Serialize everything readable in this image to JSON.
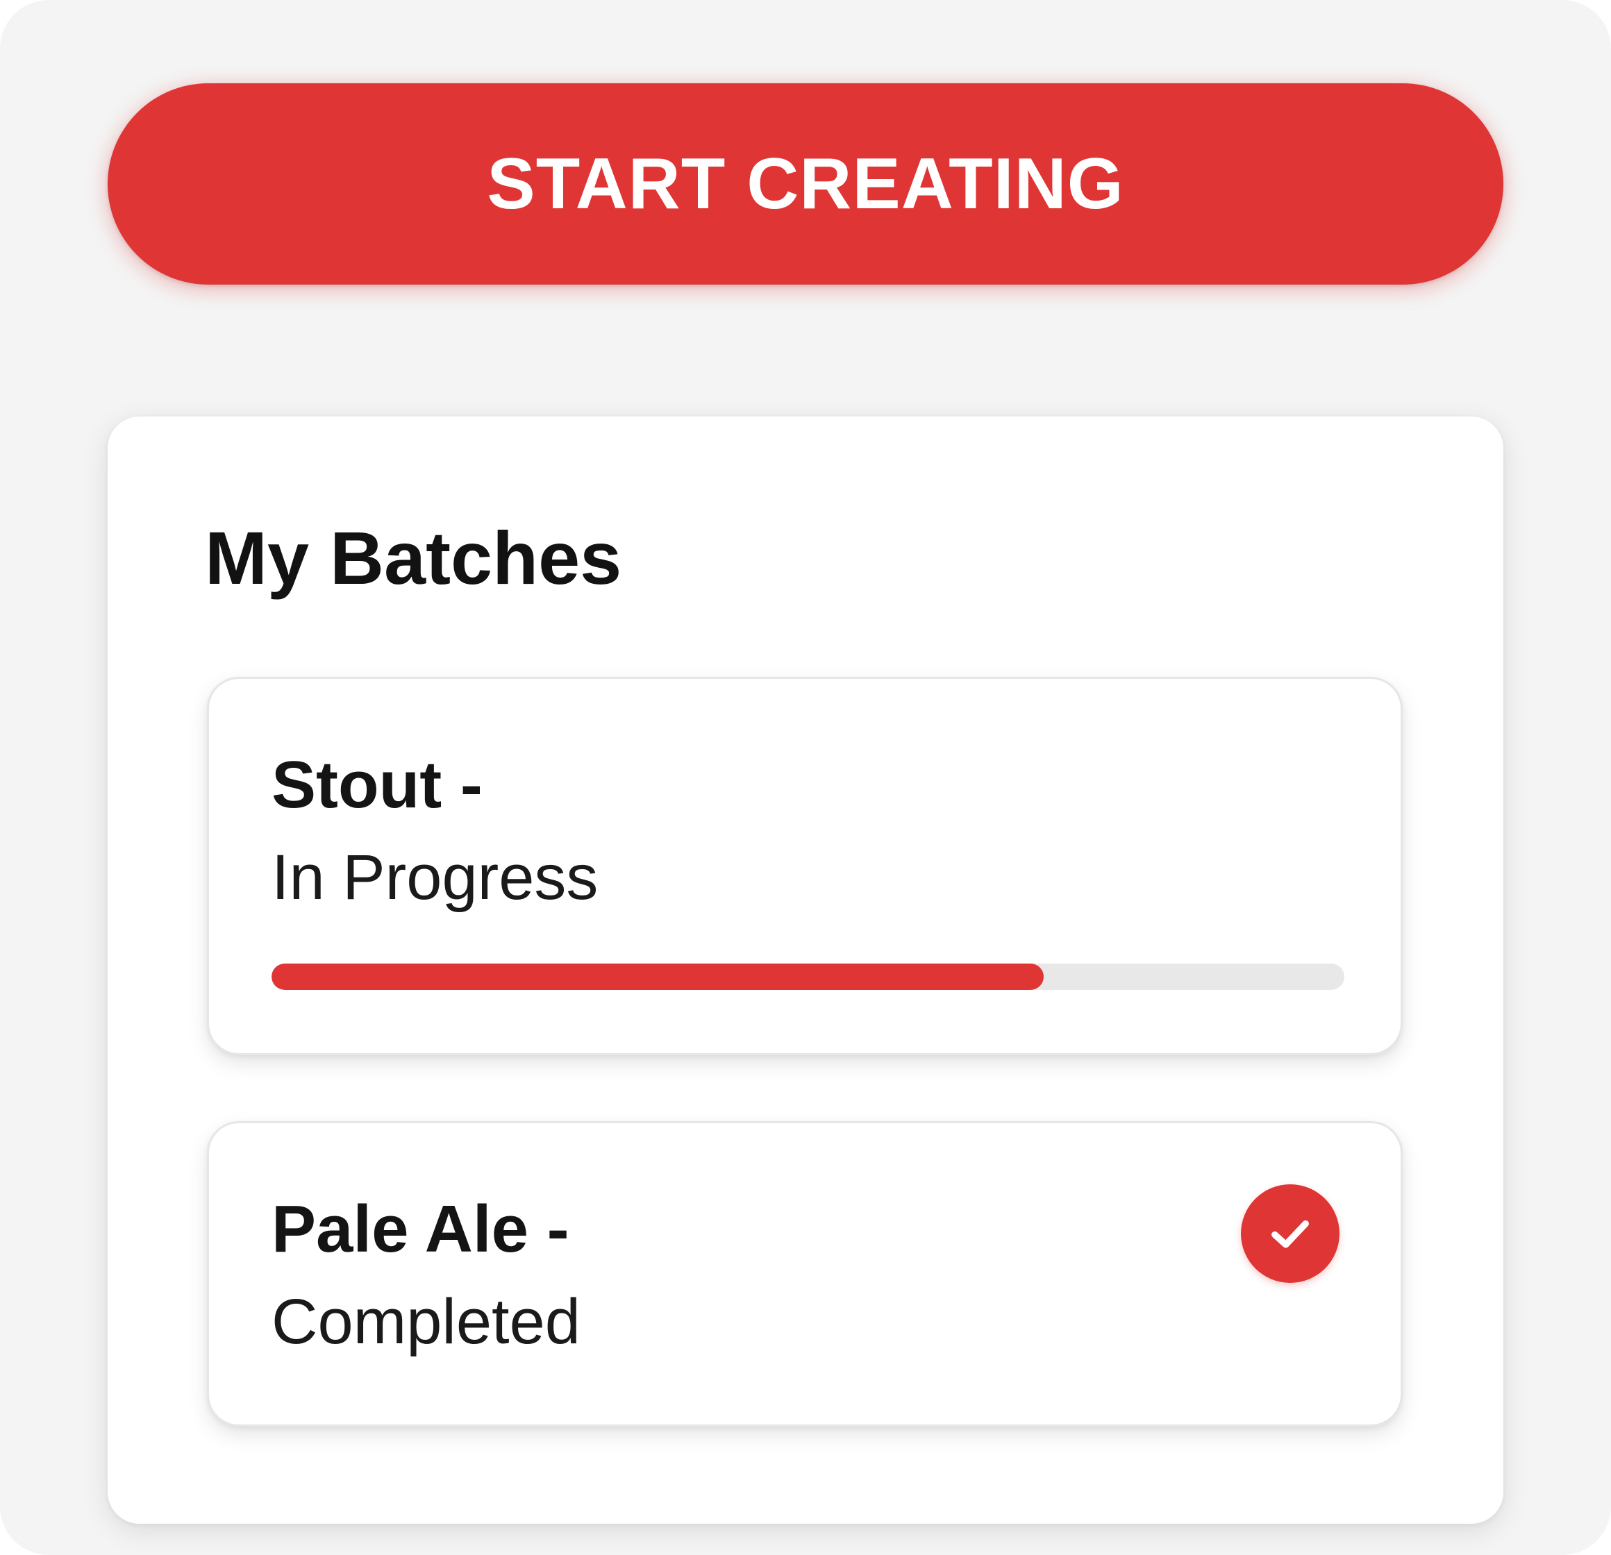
{
  "start_button": {
    "label": "START CREATING"
  },
  "batches": {
    "title": "My Batches",
    "items": [
      {
        "name": "Stout -",
        "status": "In Progress",
        "progress": 0.72
      },
      {
        "name": "Pale Ale -",
        "status": "Completed",
        "icon": "check-circle-icon"
      }
    ]
  },
  "colors": {
    "accent": "#df3535",
    "track": "#e8e8e8",
    "background": "#f4f4f4",
    "card": "#ffffff",
    "text": "#141414"
  }
}
